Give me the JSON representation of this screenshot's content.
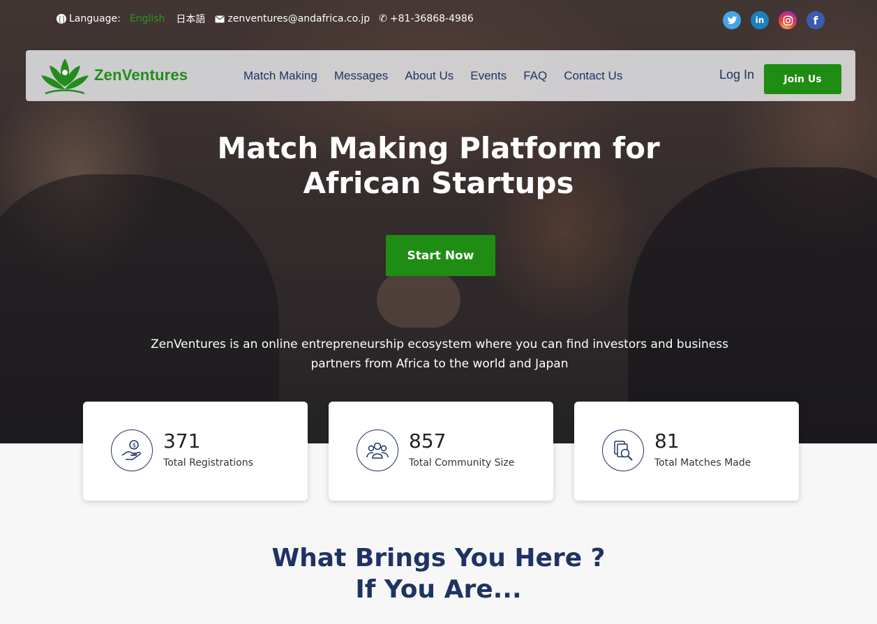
{
  "topbar": {
    "language_label": "Language:",
    "lang_english": "English",
    "lang_japanese": "日本語",
    "email": "zenventures@andafrica.co.jp",
    "phone": "+81-36868-4986"
  },
  "socials": [
    "twitter-icon",
    "linkedin-icon",
    "instagram-icon",
    "facebook-icon"
  ],
  "nav": {
    "brand": "ZenVentures",
    "links": [
      "Match Making",
      "Messages",
      "About Us",
      "Events",
      "FAQ",
      "Contact Us"
    ],
    "login": "Log In",
    "join": "Join Us"
  },
  "hero": {
    "title_line1": "Match Making Platform for",
    "title_line2": "African Startups",
    "cta": "Start Now",
    "description": "ZenVentures is an online entrepreneurship ecosystem where you can find investors and business partners from Africa to the world and Japan"
  },
  "stats": [
    {
      "value": "371",
      "label": "Total Registrations",
      "icon": "hand-coin-icon"
    },
    {
      "value": "857",
      "label": "Total Community Size",
      "icon": "community-icon"
    },
    {
      "value": "81",
      "label": "Total Matches Made",
      "icon": "search-documents-icon"
    }
  ],
  "section": {
    "title_line1": "What Brings You Here ?",
    "title_line2": "If You Are..."
  },
  "colors": {
    "brand_green": "#1f8c13",
    "navy": "#1f3363",
    "english_active": "#2a9b17"
  }
}
